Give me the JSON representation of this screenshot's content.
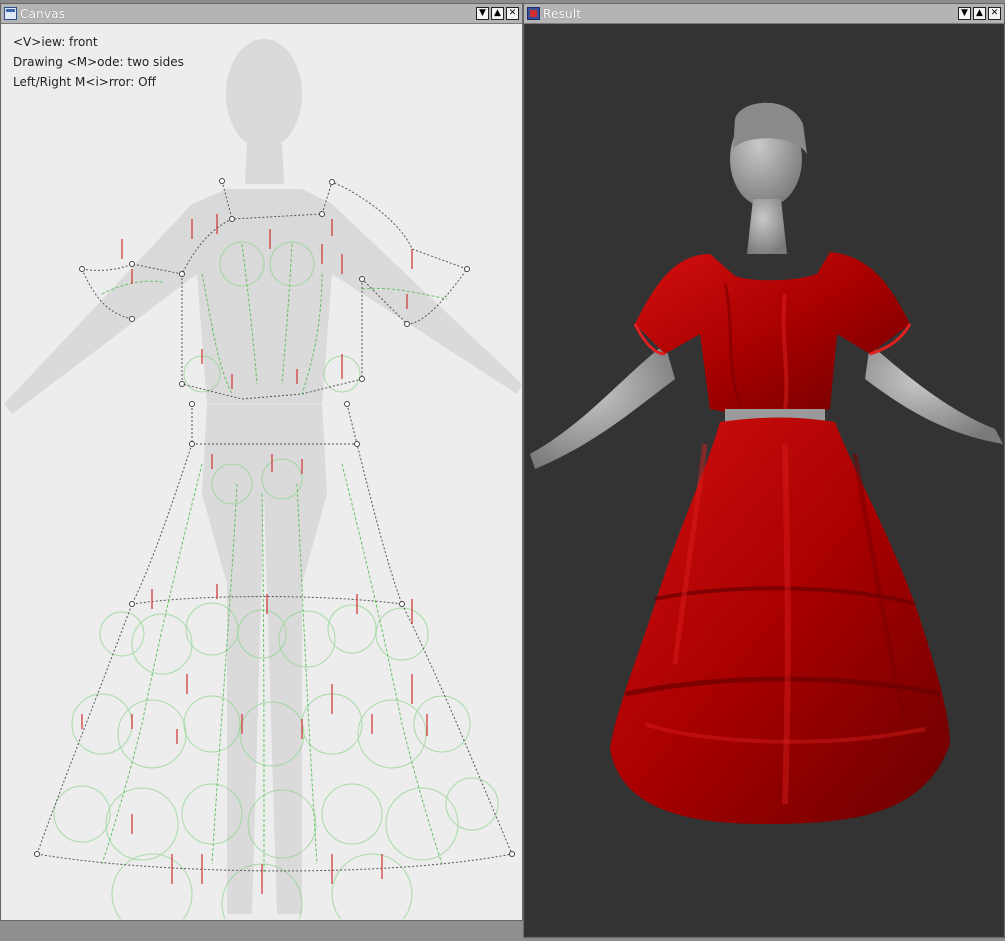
{
  "canvas_window": {
    "title": "Canvas",
    "buttons": {
      "minimize": "▼",
      "maximize": "▲",
      "close": "✕"
    },
    "overlay": {
      "view": "<V>iew: front",
      "mode": "Drawing <M>ode: two sides",
      "mirror": "Left/Right M<i>rror: Off"
    }
  },
  "result_window": {
    "title": "Result",
    "buttons": {
      "minimize": "▼",
      "maximize": "▲",
      "close": "✕"
    }
  },
  "icons": {
    "canvas_icon": "window-app-icon",
    "result_icon": "window-app-icon"
  },
  "colors": {
    "canvas_bg": "#ededed",
    "result_bg": "#333333",
    "garment": "#b00000",
    "sketch_green": "#5fbf5f",
    "sketch_red": "#d23030"
  }
}
